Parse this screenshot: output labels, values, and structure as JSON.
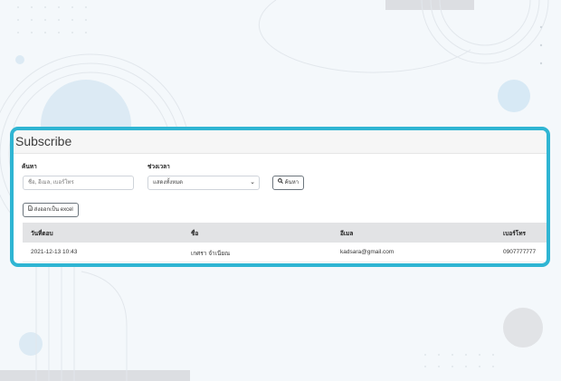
{
  "card": {
    "title": "Subscribe"
  },
  "search": {
    "label": "ค้นหา",
    "placeholder": "ชื่อ, อีเมล, เบอร์โทร"
  },
  "period": {
    "label": "ช่วงเวลา",
    "selected": "แสดงทั้งหมด"
  },
  "buttons": {
    "search": "ค้นหา",
    "export": "ส่งออกเป็น excel"
  },
  "table": {
    "headers": [
      "วันที่ตอบ",
      "ชื่อ",
      "อีเมล",
      "เบอร์โทร"
    ],
    "rows": [
      [
        "2021-12-13 10:43",
        "เกศรา จำเนียณ",
        "kadsara@gmail.com",
        "0907777777"
      ]
    ]
  },
  "colors": {
    "accent_border": "#2fb5d3",
    "header_bg": "#e2e3e5"
  }
}
